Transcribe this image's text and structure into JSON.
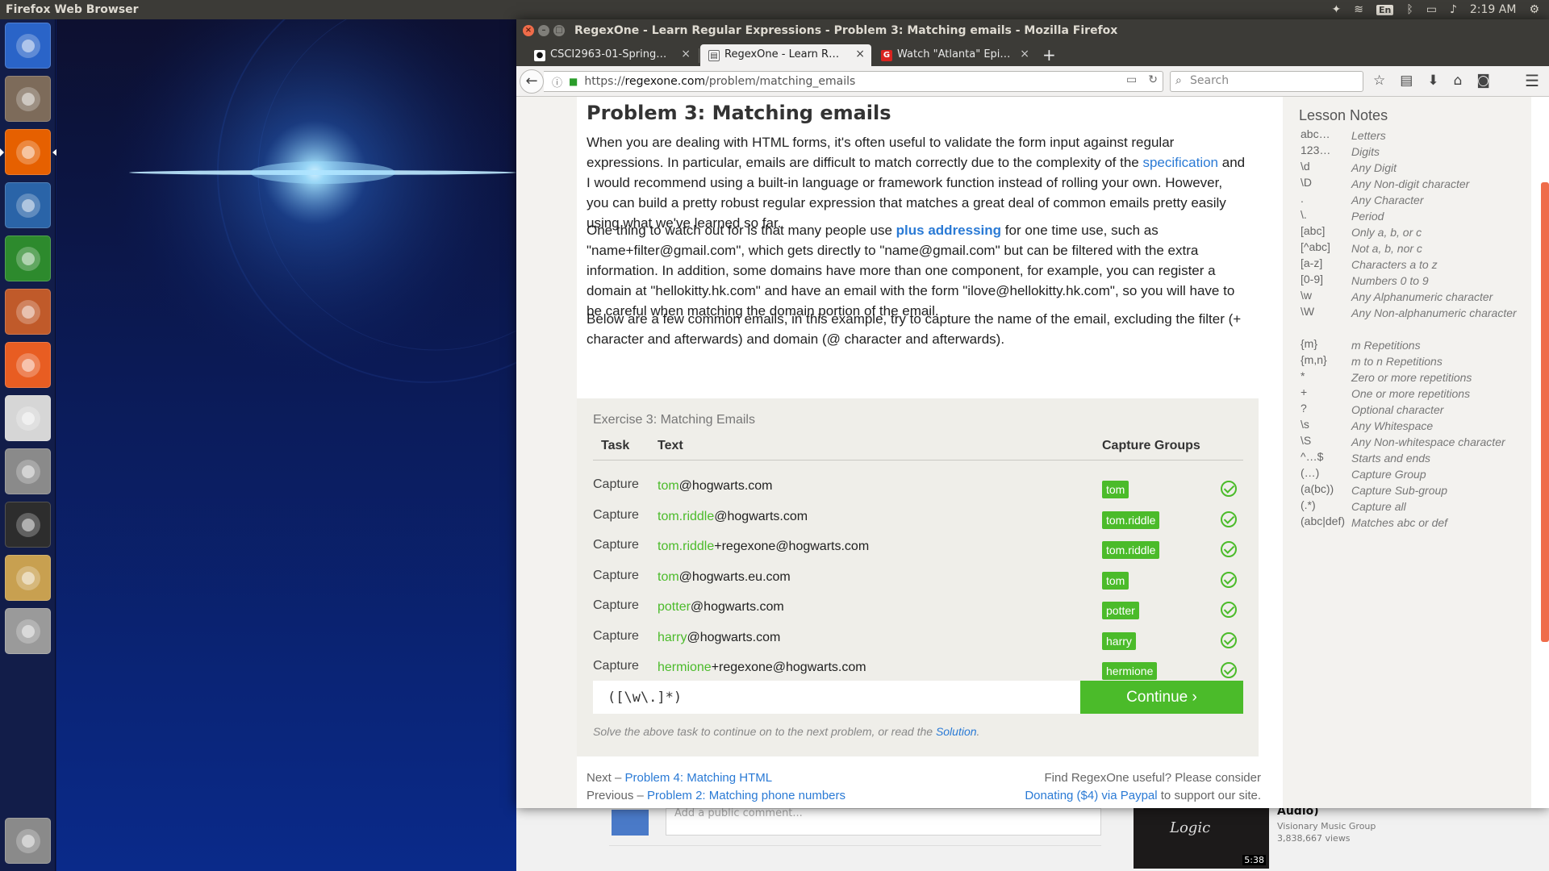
{
  "top_panel": {
    "app_title": "Firefox Web Browser",
    "keyboard_layout": "En",
    "clock": "2:19 AM"
  },
  "launcher": {
    "items": [
      {
        "name": "ubuntu-dash-icon",
        "color": "#2a64c8"
      },
      {
        "name": "files-icon",
        "color": "#7d6b5a"
      },
      {
        "name": "firefox-icon",
        "color": "#e66000"
      },
      {
        "name": "libreoffice-impress-icon",
        "color": "#2a64a8"
      },
      {
        "name": "libreoffice-calc-icon",
        "color": "#2d8a2d"
      },
      {
        "name": "libreoffice-impress-orange-icon",
        "color": "#c05a2a"
      },
      {
        "name": "ubuntu-software-icon",
        "color": "#e85d22"
      },
      {
        "name": "amazon-icon",
        "color": "#d6d6d6"
      },
      {
        "name": "system-settings-icon",
        "color": "#8a8a8a"
      },
      {
        "name": "terminal-icon",
        "color": "#2d2d2d"
      },
      {
        "name": "system-monitor-icon",
        "color": "#c8a050"
      },
      {
        "name": "disks-icon",
        "color": "#9a9a9a"
      },
      {
        "name": "trash-icon",
        "color": "#8a8a8a"
      }
    ]
  },
  "window": {
    "title": "RegexOne - Learn Regular Expressions - Problem 3: Matching emails - Mozilla Firefox"
  },
  "tabs": [
    {
      "label": "CSCI2963-01-Spring…",
      "favicon": "github-icon"
    },
    {
      "label": "RegexOne - Learn R…",
      "favicon": "regexone-icon"
    },
    {
      "label": "Watch \"Atlanta\" Epi…",
      "favicon": "red-g-icon"
    }
  ],
  "nav": {
    "url_prefix": "https://",
    "url_host": "regexone.com",
    "url_path": "/problem/matching_emails",
    "search_placeholder": "Search"
  },
  "article": {
    "title": "Problem 3: Matching emails",
    "p1_a": "When you are dealing with HTML forms, it's often useful to validate the form input against regular expressions. In particular, emails are difficult to match correctly due to the complexity of the ",
    "p1_link": "specification",
    "p1_b": " and I would recommend using a built-in language or framework function instead of rolling your own. However, you can build a pretty robust regular expression that matches a great deal of common emails pretty easily using what we've learned so far.",
    "p2_a": "One thing to watch out for is that many people use ",
    "p2_link": "plus addressing",
    "p2_b": " for one time use, such as \"name+filter@gmail.com\", which gets directly to \"name@gmail.com\" but can be filtered with the extra information. In addition, some domains have more than one component, for example, you can register a domain at \"hellokitty.hk.com\" and have an email with the form \"ilove@hellokitty.hk.com\", so you will have to be careful when matching the domain portion of the email.",
    "p3": "Below are a few common emails, in this example, try to capture the name of the email, excluding the filter (+ character and afterwards) and domain (@ character and afterwards)."
  },
  "exercise": {
    "title": "Exercise 3: Matching Emails",
    "col_task": "Task",
    "col_text": "Text",
    "col_capture": "Capture Groups",
    "rows": [
      {
        "task": "Capture",
        "hl": "tom",
        "rest": "@hogwarts.com",
        "capture": "tom"
      },
      {
        "task": "Capture",
        "hl": "tom.riddle",
        "rest": "@hogwarts.com",
        "capture": "tom.riddle"
      },
      {
        "task": "Capture",
        "hl": "tom.riddle",
        "rest": "+regexone@hogwarts.com",
        "capture": "tom.riddle"
      },
      {
        "task": "Capture",
        "hl": "tom",
        "rest": "@hogwarts.eu.com",
        "capture": "tom"
      },
      {
        "task": "Capture",
        "hl": "potter",
        "rest": "@hogwarts.com",
        "capture": "potter"
      },
      {
        "task": "Capture",
        "hl": "harry",
        "rest": "@hogwarts.com",
        "capture": "harry"
      },
      {
        "task": "Capture",
        "hl": "hermione",
        "rest": "+regexone@hogwarts.com",
        "capture": "hermione"
      }
    ],
    "input_value": "([\\w\\.]*)",
    "continue_label": "Continue ›",
    "solve_note_a": "Solve the above task to continue on to the next problem, or read the ",
    "solve_note_link": "Solution",
    "solve_note_b": "."
  },
  "footer_nav": {
    "next_label": "Next – ",
    "next_link": "Problem 4: Matching HTML",
    "prev_label": "Previous – ",
    "prev_link": "Problem 2: Matching phone numbers",
    "donate_text": "Find RegexOne useful? Please consider",
    "donate_link": "Donating ($4) via Paypal",
    "donate_tail": " to support our site."
  },
  "lesson_notes": {
    "title": "Lesson Notes",
    "items": [
      {
        "k": "abc…",
        "v": "Letters"
      },
      {
        "k": "123…",
        "v": "Digits"
      },
      {
        "k": "\\d",
        "v": "Any Digit"
      },
      {
        "k": "\\D",
        "v": "Any Non-digit character"
      },
      {
        "k": ".",
        "v": "Any Character"
      },
      {
        "k": "\\.",
        "v": "Period"
      },
      {
        "k": "[abc]",
        "v": "Only a, b, or c"
      },
      {
        "k": "[^abc]",
        "v": "Not a, b, nor c"
      },
      {
        "k": "[a-z]",
        "v": "Characters a to z"
      },
      {
        "k": "[0-9]",
        "v": "Numbers 0 to 9"
      },
      {
        "k": "\\w",
        "v": "Any Alphanumeric character"
      },
      {
        "k": "\\W",
        "v": "Any Non-alphanumeric character"
      },
      {
        "k": "{m}",
        "v": "m Repetitions"
      },
      {
        "k": "{m,n}",
        "v": "m to n Repetitions"
      },
      {
        "k": "*",
        "v": "Zero or more repetitions"
      },
      {
        "k": "+",
        "v": "One or more repetitions"
      },
      {
        "k": "?",
        "v": "Optional character"
      },
      {
        "k": "\\s",
        "v": "Any Whitespace"
      },
      {
        "k": "\\S",
        "v": "Any Non-whitespace character"
      },
      {
        "k": "^…$",
        "v": "Starts and ends"
      },
      {
        "k": "(…)",
        "v": "Capture Group"
      },
      {
        "k": "(a(bc))",
        "v": "Capture Sub-group"
      },
      {
        "k": "(.*)",
        "v": "Capture all"
      },
      {
        "k": "(abc|def)",
        "v": "Matches abc or def"
      }
    ]
  },
  "behind": {
    "comment_placeholder": "Add a public comment...",
    "video_title": "Audio)",
    "video_channel": "Visionary Music Group",
    "video_views": "3,838,667 views",
    "thumb_text": "Logic",
    "duration": "5:38"
  }
}
